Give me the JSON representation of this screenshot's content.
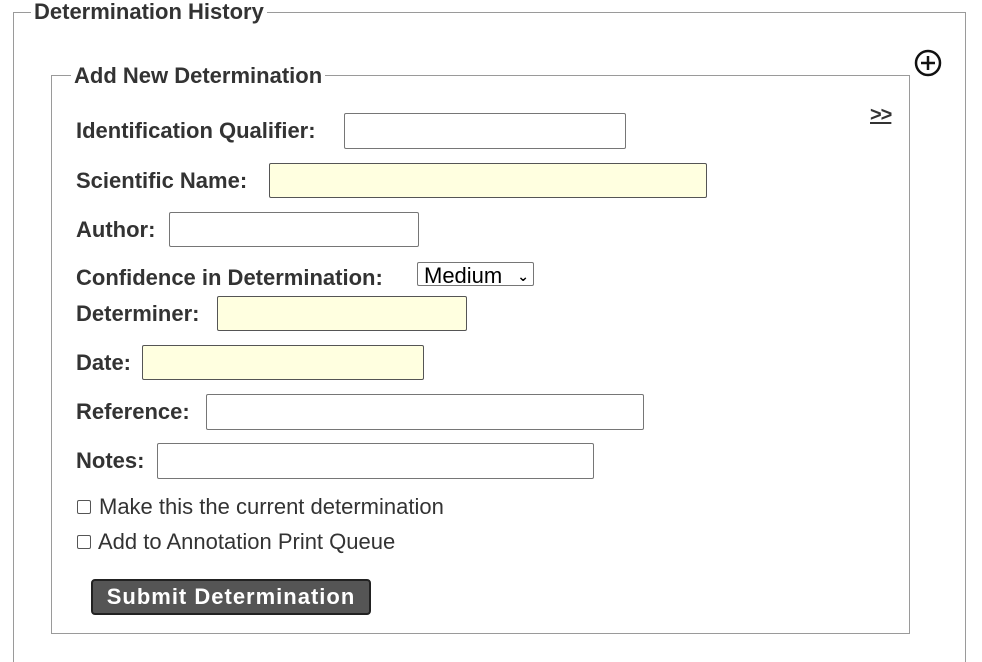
{
  "determination_history": {
    "legend": "Determination History",
    "add_icon": "plus-circle-icon"
  },
  "add_new": {
    "legend": "Add New Determination",
    "toggle_link": ">>",
    "fields": {
      "identification_qualifier": {
        "label": "Identification Qualifier:",
        "value": ""
      },
      "scientific_name": {
        "label": "Scientific Name:",
        "value": ""
      },
      "author": {
        "label": "Author:",
        "value": ""
      },
      "confidence": {
        "label": "Confidence in Determination:",
        "selected": "Medium"
      },
      "determiner": {
        "label": "Determiner:",
        "value": ""
      },
      "date": {
        "label": "Date:",
        "value": ""
      },
      "reference": {
        "label": "Reference:",
        "value": ""
      },
      "notes": {
        "label": "Notes:",
        "value": ""
      }
    },
    "checkboxes": {
      "make_current": {
        "label": "Make this the current determination",
        "checked": false
      },
      "print_queue": {
        "label": "Add to Annotation Print Queue",
        "checked": false
      }
    },
    "submit_label": "Submit Determination"
  },
  "colors": {
    "required_field_bg": "#ffffe0",
    "button_bg": "#555555",
    "border": "#9a9a9a"
  }
}
